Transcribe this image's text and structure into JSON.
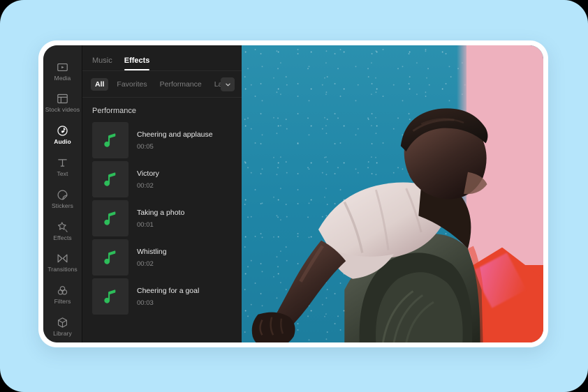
{
  "theme": {
    "canvas_bg": "#b5e5fb",
    "window_frame": "#ffffff",
    "rail_bg": "#232323",
    "panel_bg": "#1e1e1e",
    "thumb_bg": "#2c2c2c",
    "accent_green": "#2dbd5a",
    "active_text": "#ffffff",
    "muted_text": "#8d8d8d",
    "chip_active_bg": "#343434",
    "preview_sky": "#2189a9",
    "preview_pink": "#eeb1be",
    "preview_red": "#e8442b"
  },
  "sidebar": {
    "items": [
      {
        "label": "Media",
        "icon": "media-icon",
        "active": false
      },
      {
        "label": "Stock videos",
        "icon": "stock-videos-icon",
        "active": false
      },
      {
        "label": "Audio",
        "icon": "audio-icon",
        "active": true
      },
      {
        "label": "Text",
        "icon": "text-icon",
        "active": false
      },
      {
        "label": "Stickers",
        "icon": "stickers-icon",
        "active": false
      },
      {
        "label": "Effects",
        "icon": "effects-icon",
        "active": false
      },
      {
        "label": "Transitions",
        "icon": "transitions-icon",
        "active": false
      },
      {
        "label": "Filters",
        "icon": "filters-icon",
        "active": false
      },
      {
        "label": "Library",
        "icon": "library-icon",
        "active": false
      }
    ]
  },
  "panel": {
    "tabs": [
      {
        "label": "Music",
        "active": false
      },
      {
        "label": "Effects",
        "active": true
      }
    ],
    "chips": [
      {
        "label": "All",
        "active": true
      },
      {
        "label": "Favorites",
        "active": false
      },
      {
        "label": "Performance",
        "active": false
      },
      {
        "label": "Laugh",
        "active": false
      }
    ],
    "more_icon": "chevron-down-icon",
    "section_title": "Performance",
    "items": [
      {
        "title": "Cheering and applause",
        "duration": "00:05",
        "icon": "music-note-icon"
      },
      {
        "title": "Victory",
        "duration": "00:02",
        "icon": "music-note-icon"
      },
      {
        "title": "Taking a photo",
        "duration": "00:01",
        "icon": "music-note-icon"
      },
      {
        "title": "Whistling",
        "duration": "00:02",
        "icon": "music-note-icon"
      },
      {
        "title": "Cheering for a goal",
        "duration": "00:03",
        "icon": "music-note-icon"
      }
    ]
  },
  "preview": {
    "description": "Photo of a person from a low angle against a teal sky with a pink and red color-split overlay on the right"
  }
}
